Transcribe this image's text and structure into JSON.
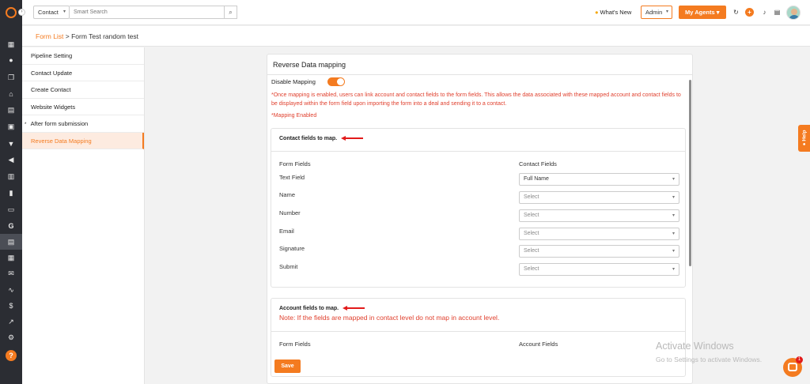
{
  "topbar": {
    "module_select": "Contact",
    "search_placeholder": "Smart Search",
    "whats_new": "What's New",
    "role_select": "Admin",
    "my_agents": "My Agents"
  },
  "breadcrumb": {
    "parent": "Form List",
    "separator": " > ",
    "current": "Form Test random test"
  },
  "subnav": {
    "items": [
      {
        "label": "Pipeline Setting"
      },
      {
        "label": "Contact Update"
      },
      {
        "label": "Create Contact"
      },
      {
        "label": "Website Widgets"
      },
      {
        "label": "After form submission",
        "marker": "*"
      },
      {
        "label": "Reverse Data Mapping",
        "active": true
      }
    ]
  },
  "card": {
    "title": "Reverse Data mapping",
    "toggle_label": "Disable Mapping",
    "toggle_on": true,
    "note": "*Once mapping is enabled, users can link account and contact fields to the form fields. This allows the data associated with these mapped account and contact fields to be displayed within the form field upon importing the form into a deal and sending it to a contact.",
    "status": "*Mapping Enabled",
    "contact_section": {
      "heading": "Contact fields to map.",
      "col_left": "Form Fields",
      "col_right": "Contact Fields",
      "rows": [
        {
          "field": "Text Field",
          "value": "Full Name",
          "selected": true
        },
        {
          "field": "Name",
          "value": "Select"
        },
        {
          "field": "Number",
          "value": "Select"
        },
        {
          "field": "Email",
          "value": "Select"
        },
        {
          "field": "Signature",
          "value": "Select"
        },
        {
          "field": "Submit",
          "value": "Select"
        }
      ]
    },
    "account_section": {
      "heading": "Account fields to map.",
      "note": "Note: If the fields are mapped in contact level do not map in account level.",
      "col_left": "Form Fields",
      "col_right": "Account Fields"
    },
    "save_label": "Save"
  },
  "help_tab": "Help",
  "chat_badge": "1",
  "watermark": {
    "line1": "Activate Windows",
    "line2": "Go to Settings to activate Windows."
  },
  "colors": {
    "accent": "#f47b20",
    "rail": "#2b2d33",
    "warning_text": "#e0402e",
    "annotation_arrow": "#e21b1b"
  },
  "icons": [
    "logo-icon",
    "dashboard-icon",
    "contacts-icon",
    "copy-icon",
    "bank-icon",
    "deals-icon",
    "contact-card-icon",
    "filter-icon",
    "megaphone-icon",
    "document-icon",
    "chart-icon",
    "folder-icon",
    "google-icon",
    "forms-icon",
    "calendar-icon",
    "mail-icon",
    "wave-icon",
    "dollar-icon",
    "analytics-icon",
    "settings-icon",
    "help-icon"
  ]
}
